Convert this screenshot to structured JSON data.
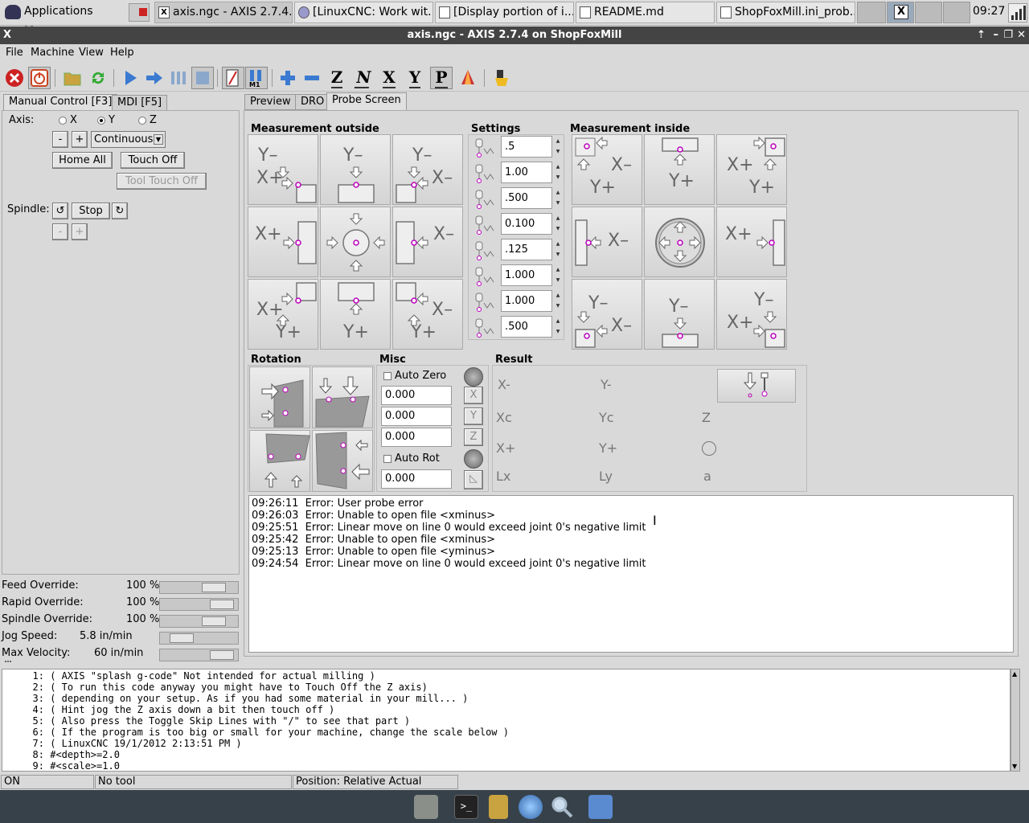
{
  "panel": {
    "apps_menu": "Applications Menu",
    "tasks": [
      {
        "label": "axis.ngc - AXIS 2.7.4...",
        "icon": "x-icon"
      },
      {
        "label": "[LinuxCNC: Work wit...",
        "icon": "browser-icon"
      },
      {
        "label": "[Display portion of i...",
        "icon": "document-icon"
      },
      {
        "label": "README.md",
        "icon": "editor-icon"
      },
      {
        "label": "ShopFoxMill.ini_prob...",
        "icon": "editor-icon"
      }
    ],
    "clock": "09:27"
  },
  "window": {
    "title": "axis.ngc - AXIS 2.7.4 on ShopFoxMill",
    "icon": "X"
  },
  "menubar": [
    {
      "label": "File"
    },
    {
      "label": "Machine"
    },
    {
      "label": "View"
    },
    {
      "label": "Help"
    }
  ],
  "left": {
    "tabs": [
      "Manual Control [F3]",
      "MDI [F5]"
    ],
    "axis_label": "Axis:",
    "axes": [
      "X",
      "Y",
      "Z"
    ],
    "selected_axis": "Y",
    "minus": "-",
    "plus": "+",
    "jog_mode": "Continuous",
    "touch_off": "Touch Off",
    "home_all": "Home All",
    "tool_touch_off": "Tool Touch Off",
    "spindle_label": "Spindle:",
    "stop": "Stop",
    "overrides": [
      {
        "label": "Feed Override:",
        "value": "100 %",
        "level": 0.77
      },
      {
        "label": "Rapid Override:",
        "value": "100 %",
        "level": 0.92
      },
      {
        "label": "Spindle Override:",
        "value": "100 %",
        "level": 0.77
      },
      {
        "label": "Jog Speed:",
        "value": "5.8 in/min",
        "level": 0.18
      },
      {
        "label": "Max Velocity:",
        "value": "60 in/min",
        "level": 0.92
      }
    ]
  },
  "right_tabs": [
    "Preview",
    "DRO",
    "Probe Screen"
  ],
  "probe": {
    "meas_outside": "Measurement outside",
    "settings": "Settings",
    "meas_inside": "Measurement inside",
    "settings_values": [
      ".5",
      "1.00",
      ".500",
      "0.100",
      ".125",
      "1.000",
      "1.000",
      ".500"
    ],
    "rotation": "Rotation",
    "misc": "Misc",
    "result": "Result",
    "auto_zero": "Auto Zero",
    "auto_rot": "Auto Rot",
    "misc_values": [
      "0.000",
      "0.000",
      "0.000",
      "0.000"
    ],
    "result_labels": [
      "X-",
      "Y-",
      "Xc",
      "Yc",
      "Z",
      "X+",
      "Y+",
      "Lx",
      "Ly",
      "a"
    ]
  },
  "log": [
    {
      "time": "09:26:11",
      "msg": "Error: User probe error"
    },
    {
      "time": "09:26:03",
      "msg": "Error: Unable to open file <xminus>"
    },
    {
      "time": "09:25:51",
      "msg": "Error: Linear move on line 0 would exceed joint 0's negative limit"
    },
    {
      "time": "09:25:42",
      "msg": "Error: Unable to open file <xminus>"
    },
    {
      "time": "09:25:13",
      "msg": "Error: Unable to open file <yminus>"
    },
    {
      "time": "09:24:54",
      "msg": "Error: Linear move on line 0 would exceed joint 0's negative limit"
    }
  ],
  "gcode": [
    {
      "n": "1:",
      "text": "( AXIS \"splash g-code\" Not intended for actual milling )"
    },
    {
      "n": "2:",
      "text": "( To run this code anyway you might have to Touch Off the Z axis)"
    },
    {
      "n": "3:",
      "text": "( depending on your setup. As if you had some material in your mill... )"
    },
    {
      "n": "4:",
      "text": "( Hint jog the Z axis down a bit then touch off )"
    },
    {
      "n": "5:",
      "text": "( Also press the Toggle Skip Lines with \"/\" to see that part )"
    },
    {
      "n": "6:",
      "text": "( If the program is too big or small for your machine, change the scale below )"
    },
    {
      "n": "7:",
      "text": "( LinuxCNC 19/1/2012 2:13:51 PM )"
    },
    {
      "n": "8:",
      "text": "#<depth>=2.0"
    },
    {
      "n": "9:",
      "text": "#<scale>=1.0"
    }
  ],
  "status": {
    "state": "ON",
    "tool": "No tool",
    "position": "Position: Relative Actual"
  },
  "colors": {
    "probe_point": "#bb00bb",
    "estop": "#cc2222",
    "dock": "#37414a"
  }
}
